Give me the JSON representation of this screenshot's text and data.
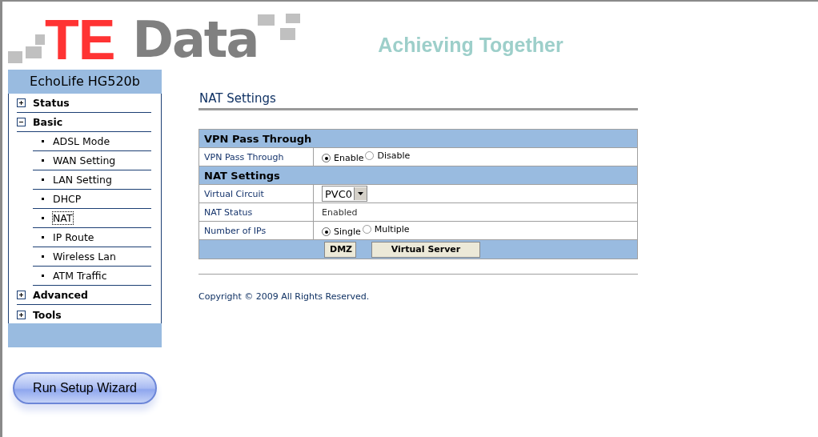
{
  "logo": {
    "part_1": "TE",
    "part_2": "Data"
  },
  "tagline": "Achieving Together",
  "sidebar": {
    "title": "EchoLife HG520b",
    "items": [
      {
        "label": "Status",
        "expanded": false
      },
      {
        "label": "Basic",
        "expanded": true,
        "children": [
          {
            "label": "ADSL Mode",
            "selected": false
          },
          {
            "label": "WAN Setting",
            "selected": false
          },
          {
            "label": "LAN Setting",
            "selected": false
          },
          {
            "label": "DHCP",
            "selected": false
          },
          {
            "label": "NAT",
            "selected": true
          },
          {
            "label": "IP Route",
            "selected": false
          },
          {
            "label": "Wireless Lan",
            "selected": false
          },
          {
            "label": "ATM Traffic",
            "selected": false
          }
        ]
      },
      {
        "label": "Advanced",
        "expanded": false
      },
      {
        "label": "Tools",
        "expanded": false
      }
    ]
  },
  "wizard_button": "Run Setup Wizard",
  "page_title": "NAT Settings",
  "sections": [
    {
      "title": "VPN Pass Through",
      "rows": [
        {
          "kind": "radio",
          "label": "VPN Pass Through",
          "options": [
            {
              "label": "Enable",
              "selected": true
            },
            {
              "label": "Disable",
              "selected": false
            }
          ]
        }
      ]
    },
    {
      "title": "NAT Settings",
      "rows": [
        {
          "kind": "select",
          "label": "Virtual Circuit",
          "value": "PVC0"
        },
        {
          "kind": "text",
          "label": "NAT Status",
          "value": "Enabled"
        },
        {
          "kind": "radio",
          "label": "Number of IPs",
          "options": [
            {
              "label": "Single",
              "selected": true
            },
            {
              "label": "Multiple",
              "selected": false
            }
          ]
        }
      ]
    }
  ],
  "buttons": [
    "DMZ",
    "Virtual Server"
  ],
  "copyright": "Copyright © 2009 All Rights Reserved."
}
